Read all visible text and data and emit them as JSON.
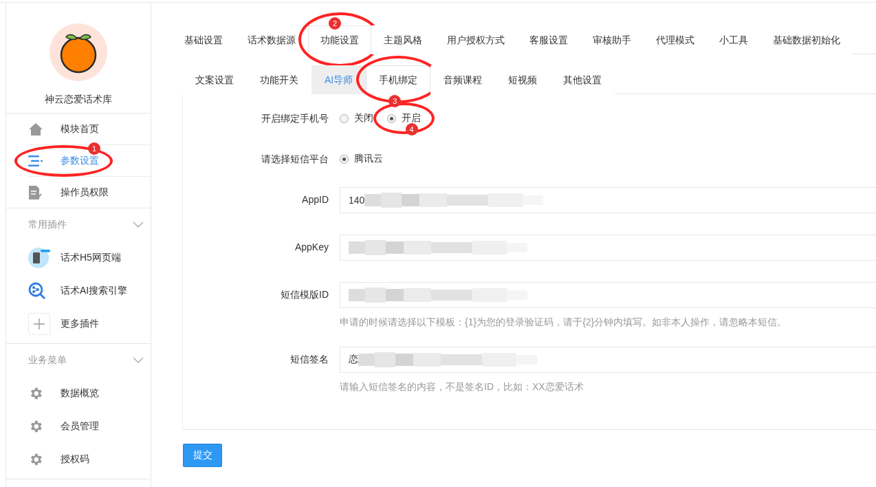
{
  "sidebar": {
    "profile": {
      "name": "神云恋爱话术库"
    },
    "nav": [
      {
        "label": "模块首页",
        "kind": "home",
        "selected": false
      },
      {
        "label": "参数设置",
        "kind": "sliders",
        "selected": true,
        "annotation": "1"
      },
      {
        "label": "操作员权限",
        "kind": "document",
        "selected": false
      }
    ],
    "groups": [
      {
        "title": "常用插件",
        "expanded": true,
        "items": [
          {
            "label": "话术H5网页端",
            "kind": "phone"
          },
          {
            "label": "话术AI搜索引擎",
            "kind": "ai-search"
          },
          {
            "label": "更多插件",
            "kind": "plus"
          }
        ]
      },
      {
        "title": "业务菜单",
        "expanded": true,
        "items": [
          {
            "label": "数据概览",
            "kind": "gear"
          },
          {
            "label": "会员管理",
            "kind": "gear"
          },
          {
            "label": "授权码",
            "kind": "gear"
          }
        ]
      }
    ]
  },
  "tabs": [
    {
      "label": "基础设置",
      "selected": false
    },
    {
      "label": "话术数据源",
      "selected": false
    },
    {
      "label": "功能设置",
      "selected": true,
      "annotation": "2"
    },
    {
      "label": "主题风格",
      "selected": false
    },
    {
      "label": "用户授权方式",
      "selected": false
    },
    {
      "label": "客服设置",
      "selected": false
    },
    {
      "label": "审核助手",
      "selected": false
    },
    {
      "label": "代理模式",
      "selected": false
    },
    {
      "label": "小工具",
      "selected": false
    },
    {
      "label": "基础数据初始化",
      "selected": false
    }
  ],
  "subtabs": [
    {
      "label": "文案设置",
      "selected": false,
      "outlined": false
    },
    {
      "label": "功能开关",
      "selected": false,
      "outlined": false
    },
    {
      "label": "AI导师",
      "selected": true,
      "outlined": false
    },
    {
      "label": "手机绑定",
      "selected": false,
      "outlined": true,
      "annotation": "3"
    },
    {
      "label": "音频课程",
      "selected": false,
      "outlined": false
    },
    {
      "label": "短视频",
      "selected": false,
      "outlined": false
    },
    {
      "label": "其他设置",
      "selected": false,
      "outlined": false
    }
  ],
  "form": [
    {
      "kind": "radio",
      "label": "开启绑定手机号",
      "options": [
        {
          "label": "关闭",
          "selected": false
        },
        {
          "label": "开启",
          "selected": true,
          "annotation": "4"
        }
      ]
    },
    {
      "kind": "radio",
      "label": "请选择短信平台",
      "options": [
        {
          "label": "腾讯云",
          "selected": true
        }
      ]
    },
    {
      "kind": "input",
      "label": "AppID",
      "value": "140",
      "redacted": true
    },
    {
      "kind": "input",
      "label": "AppKey",
      "redacted": true
    },
    {
      "kind": "input",
      "label": "短信模版ID",
      "redacted": true,
      "hint": "申请的时候请选择以下模板：{1}为您的登录验证码，请于{2}分钟内填写。如非本人操作，请忽略本短信。"
    },
    {
      "kind": "input",
      "label": "短信签名",
      "value": "恋",
      "redacted": true,
      "hint": "请输入短信签名的内容，不是签名ID，比如：XX恋爱话术"
    }
  ],
  "submit": "提交"
}
